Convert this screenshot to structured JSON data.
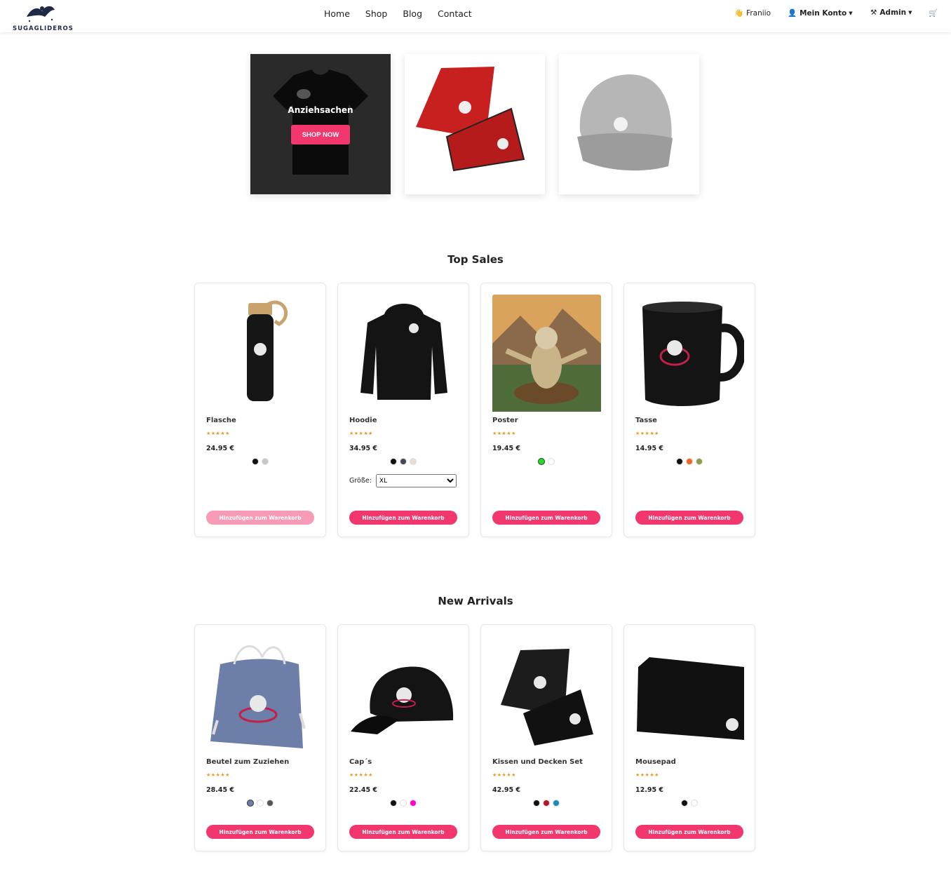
{
  "brand": {
    "name": "SUGAGLIDEROS"
  },
  "nav": {
    "links": [
      "Home",
      "Shop",
      "Blog",
      "Contact"
    ]
  },
  "user": {
    "name": "Franiio",
    "account_label": "Mein Konto",
    "admin_label": "Admin"
  },
  "banners": [
    {
      "title": "Anziehsachen",
      "button": "SHOP NOW"
    }
  ],
  "sections": {
    "top_sales": "Top Sales",
    "new_arrivals": "New Arrivals"
  },
  "top_sales": [
    {
      "name": "Flasche",
      "price": "24.95 €",
      "stars": "★★★★★",
      "colors": [
        "#111111",
        "#c8c8c8"
      ],
      "button": "Hinzufügen zum Warenkorb"
    },
    {
      "name": "Hoodie",
      "price": "34.95 €",
      "stars": "★★★★★",
      "colors": [
        "#111111",
        "#444a52",
        "#e6dfcf"
      ],
      "size_label": "Größe:",
      "size_value": "XL",
      "button": "Hinzufügen zum Warenkorb"
    },
    {
      "name": "Poster",
      "price": "19.45 €",
      "stars": "★★★★★",
      "colors": [
        "#22dd22",
        "#ffffff"
      ],
      "button": "Hinzufügen zum Warenkorb"
    },
    {
      "name": "Tasse",
      "price": "14.95 €",
      "stars": "★★★★★",
      "colors": [
        "#111111",
        "#f26522",
        "#8f9c48"
      ],
      "button": "Hinzufügen zum Warenkorb"
    }
  ],
  "new_arrivals": [
    {
      "name": "Beutel zum Zuziehen",
      "price": "28.45 €",
      "stars": "★★★★★",
      "colors": [
        "#6d7fa8",
        "#ffffff",
        "#555555"
      ],
      "button": "Hinzufügen zum Warenkorb"
    },
    {
      "name": "Cap´s",
      "price": "22.45 €",
      "stars": "★★★★★",
      "colors": [
        "#111111",
        "#ffffff",
        "#ff00cc"
      ],
      "button": "Hinzufügen zum Warenkorb"
    },
    {
      "name": "Kissen und Decken Set",
      "price": "42.95 €",
      "stars": "★★★★★",
      "colors": [
        "#111111",
        "#b3162a",
        "#1a8bb8"
      ],
      "button": "Hinzufügen zum Warenkorb"
    },
    {
      "name": "Mousepad",
      "price": "12.95 €",
      "stars": "★★★★★",
      "colors": [
        "#111111",
        "#ffffff"
      ],
      "button": "Hinzufügen zum Warenkorb"
    }
  ],
  "icons": {
    "user_emoji": "wave-hand-icon",
    "account": "user-icon",
    "admin": "tools-icon",
    "cart": "cart-icon"
  },
  "accent_color": "#f2376f"
}
